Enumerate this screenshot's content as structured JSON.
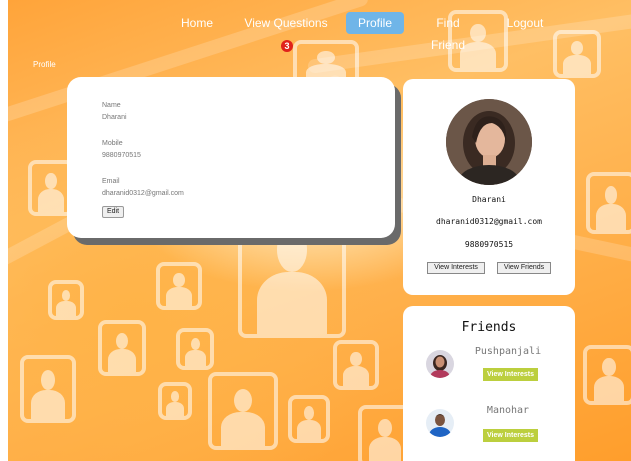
{
  "nav": {
    "items": [
      {
        "label": "Home"
      },
      {
        "label": "View Questions",
        "badge": "3"
      },
      {
        "label": "Profile",
        "active": true
      },
      {
        "label": "Find Friend"
      },
      {
        "label": "Logout"
      }
    ]
  },
  "breadcrumb": "Profile",
  "details": {
    "name_label": "Name",
    "name_value": "Dharani",
    "mobile_label": "Mobile",
    "mobile_value": "9880970515",
    "email_label": "Email",
    "email_value": "dharanid0312@gmail.com",
    "edit_label": "Edit"
  },
  "profile_card": {
    "name": "Dharani",
    "email": "dharanid0312@gmail.com",
    "phone": "9880970515",
    "view_interests_label": "View Interests",
    "view_friends_label": "View Friends"
  },
  "friends": {
    "title": "Friends",
    "list": [
      {
        "name": "Pushpanjali",
        "button": "View Interests"
      },
      {
        "name": "Manohar",
        "button": "View Interests"
      }
    ]
  },
  "colors": {
    "accent": "#6fb5e8",
    "badge": "#e0211b",
    "interest_button": "#bccf3e",
    "background": "#ffa43a"
  }
}
